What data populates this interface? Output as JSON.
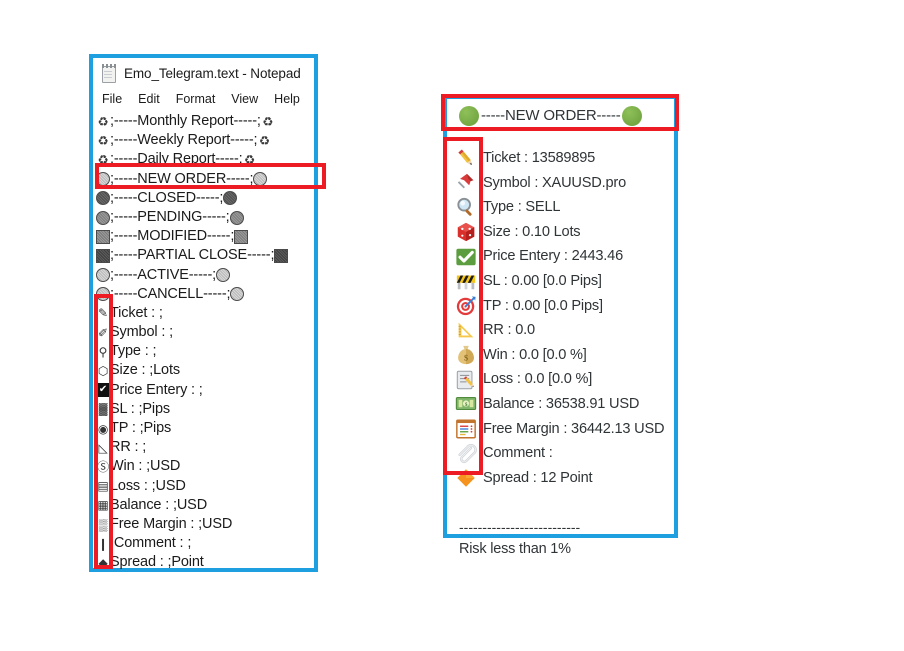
{
  "notepad": {
    "title": "Emo_Telegram.text - Notepad",
    "icon": "notepad-icon",
    "menu": [
      "File",
      "Edit",
      "Format",
      "View",
      "Help"
    ],
    "lines": [
      {
        "icon": "recycle-symbol",
        "icon_right": "recycle-symbol",
        "text": ";-----Monthly Report-----;"
      },
      {
        "icon": "recycle-symbol",
        "icon_right": "recycle-symbol",
        "text": ";-----Weekly Report-----;"
      },
      {
        "icon": "recycle-symbol",
        "icon_right": "recycle-symbol",
        "text": ";-----Daily Report-----;"
      },
      {
        "icon": "green-circle-mono",
        "icon_right": "green-circle-mono",
        "text": ";-----NEW ORDER-----;"
      },
      {
        "icon": "dark-circle-mono",
        "icon_right": "dark-circle-mono",
        "text": ";-----CLOSED-----;"
      },
      {
        "icon": "mid-circle-mono",
        "icon_right": "mid-circle-mono",
        "text": ";-----PENDING-----;"
      },
      {
        "icon": "square-mono",
        "icon_right": "square-mono",
        "text": ";-----MODIFIED-----;"
      },
      {
        "icon": "dark-square-mono",
        "icon_right": "dark-square-mono",
        "text": ";-----PARTIAL CLOSE-----;"
      },
      {
        "icon": "light-circle-mono",
        "icon_right": "light-circle-mono",
        "text": ";-----ACTIVE-----;"
      },
      {
        "icon": "light-circle-mono",
        "icon_right": "light-circle-mono",
        "text": ";-----CANCELL-----;"
      },
      {
        "icon": "pencil-mono",
        "icon_right": "",
        "text": "Ticket : ;"
      },
      {
        "icon": "pushpin-mono",
        "icon_right": "",
        "text": "Symbol : ;"
      },
      {
        "icon": "magnifier-mono",
        "icon_right": "",
        "text": "Type : ;"
      },
      {
        "icon": "dice-mono",
        "icon_right": "",
        "text": "Size : ;Lots"
      },
      {
        "icon": "checkmark-mono",
        "icon_right": "",
        "text": "Price Entery : ;"
      },
      {
        "icon": "barrier-mono",
        "icon_right": "",
        "text": "SL : ;Pips"
      },
      {
        "icon": "target-mono",
        "icon_right": "",
        "text": "TP : ;Pips"
      },
      {
        "icon": "triangle-ruler-mono",
        "icon_right": "",
        "text": "RR : ;"
      },
      {
        "icon": "moneybag-mono",
        "icon_right": "",
        "text": "Win : ;USD"
      },
      {
        "icon": "memo-mono",
        "icon_right": "",
        "text": "Loss : ;USD"
      },
      {
        "icon": "banknote-mono",
        "icon_right": "",
        "text": "Balance : ;USD"
      },
      {
        "icon": "ledger-mono",
        "icon_right": "",
        "text": "Free Margin : ;USD"
      },
      {
        "icon": "paperclip-mono",
        "icon_right": "",
        "text": ";Comment : ;"
      },
      {
        "icon": "diamond-mono",
        "icon_right": "",
        "text": "Spread : ;Point"
      }
    ]
  },
  "telegram": {
    "header": {
      "left_icon": "green-circle-emoji",
      "right_icon": "green-circle-emoji",
      "text": "-----NEW ORDER-----"
    },
    "rows": [
      {
        "icon": "pencil-emoji",
        "text": "Ticket : 13589895"
      },
      {
        "icon": "pushpin-emoji",
        "text": "Symbol : XAUUSD.pro"
      },
      {
        "icon": "magnifier-emoji",
        "text": "Type : SELL"
      },
      {
        "icon": "dice-emoji",
        "text": "Size : 0.10 Lots"
      },
      {
        "icon": "check-mark-emoji",
        "text": "Price Entery : 2443.46"
      },
      {
        "icon": "construction-emoji",
        "text": "SL : 0.00   [0.0  Pips]"
      },
      {
        "icon": "dart-emoji",
        "text": "TP : 0.00   [0.0  Pips]"
      },
      {
        "icon": "triangular-ruler-emoji",
        "text": "RR : 0.0"
      },
      {
        "icon": "money-bag-emoji",
        "text": "Win : 0.0   [0.0 %]"
      },
      {
        "icon": "memo-emoji",
        "text": "Loss : 0.0   [0.0 %]"
      },
      {
        "icon": "banknote-emoji",
        "text": "Balance : 36538.91 USD"
      },
      {
        "icon": "ledger-emoji",
        "text": "Free Margin : 36442.13 USD"
      },
      {
        "icon": "paperclip-emoji",
        "text": "Comment :"
      },
      {
        "icon": "orange-diamond-emoji",
        "text": "Spread : 12 Point"
      }
    ],
    "footer": {
      "divider": "--------------------------",
      "note": "Risk less than 1%"
    }
  },
  "annotations": {
    "boxes": [
      {
        "name": "new-order-line-highlight"
      },
      {
        "name": "notepad-emoji-column-highlight"
      },
      {
        "name": "telegram-header-highlight"
      },
      {
        "name": "telegram-emoji-column-highlight"
      }
    ],
    "color": "#ED1C24"
  },
  "colors": {
    "window_border": "#1E9FE0",
    "annotation_red": "#ED1C24",
    "green_circle": "#7DB04A",
    "text": "#2f3437"
  }
}
